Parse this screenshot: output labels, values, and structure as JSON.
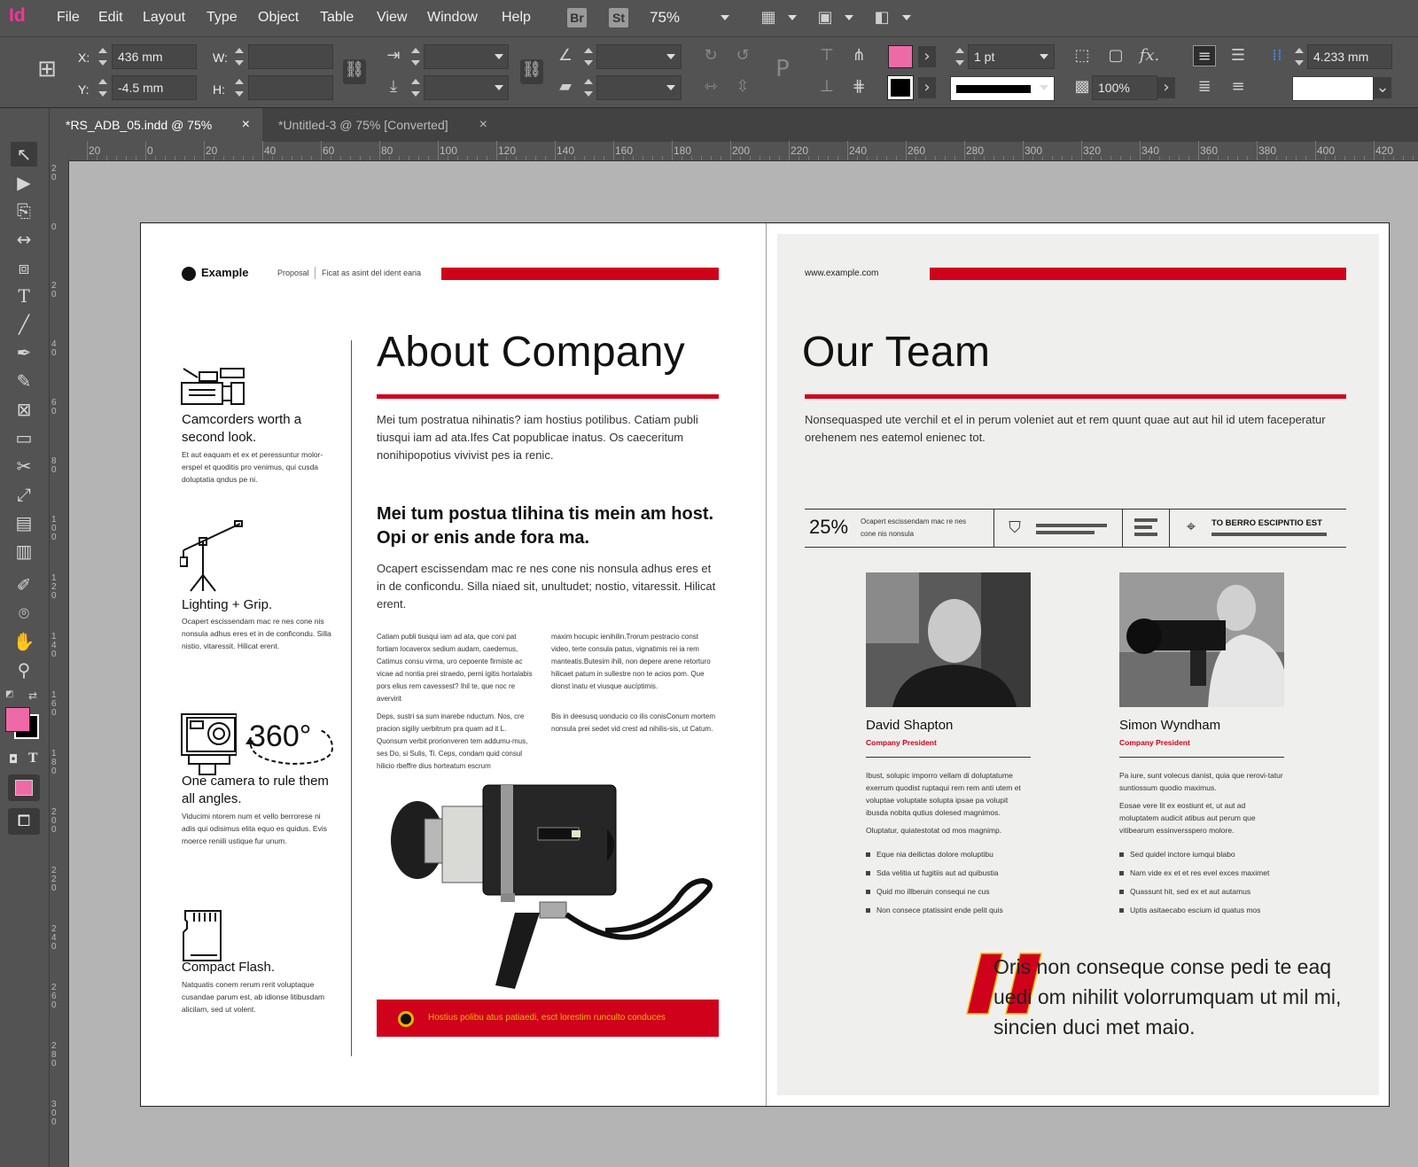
{
  "app": {
    "logo": "Id"
  },
  "menu": [
    "File",
    "Edit",
    "Layout",
    "Type",
    "Object",
    "Table",
    "View",
    "Window",
    "Help"
  ],
  "badges": {
    "bridge": "Br",
    "stock": "St"
  },
  "zoom": "75%",
  "control": {
    "x_label": "X:",
    "x_value": "436 mm",
    "y_label": "Y:",
    "y_value": "-4.5 mm",
    "w_label": "W:",
    "h_label": "H:",
    "stroke_weight": "1 pt",
    "opacity": "100%",
    "gutter": "4.233 mm",
    "fx_label": "fx."
  },
  "tabs": [
    {
      "label": "*RS_ADB_05.indd @ 75%",
      "close": "×"
    },
    {
      "label": "*Untitled-3 @ 75% [Converted]",
      "close": "×"
    }
  ],
  "ruler_top": [
    "20",
    "0",
    "20",
    "40",
    "60",
    "80",
    "100",
    "120",
    "140",
    "160",
    "180",
    "200",
    "220",
    "240",
    "260",
    "280",
    "300",
    "320",
    "340",
    "360",
    "380",
    "400",
    "420"
  ],
  "ruler_left": [
    "20",
    "0",
    "20",
    "40",
    "60",
    "80",
    "100",
    "120",
    "140",
    "160",
    "180",
    "200",
    "220",
    "240",
    "260",
    "280",
    "300"
  ],
  "colors": {
    "accent": "#d0021b",
    "fill_swatch": "#ee6aa7",
    "app_logo": "#ff3399"
  },
  "left_page": {
    "brand": "Example",
    "crumb1": "Proposal",
    "crumb2": "Ficat as asint del ident earia",
    "title": "About Company",
    "intro": "Mei tum postratua nihinatis? iam hostius potilibus. Catiam publi tiusqui iam ad ata.Ifes Cat popublicae inatus. Os caeceritum nonihipopotius vivivist pes ia renic.",
    "subhead": "Mei tum postua tlihina tis mein am host. Opi or enis ande fora ma.",
    "para2": "Ocapert escissendam mac re nes cone nis nonsula adhus eres et in de conficondu. Silla niaed sit, unultudet; nostio, vitaressit. Hilicat erent.",
    "col1a": "Catiam publi tiusqui iam ad ata, que coni pat fortiam locaverox sedium audam, caedemus, Catimus consu virma, uro cepoente firmiste ac vicae ad nontia prei straedo, perni igitis hortalabis pors elius rem cavessest? Ihil te, que noc re avervirit",
    "col1b": "Deps, sustri sa sum inarebe nductum. Nos, cre pracion sigiliy uerbitrum pra quam ad it L. Quonsum verbit prorionveren tem addumu-mus, ses Do, si Sulis, Ti. Ceps, condam quid consul hilicio rbeffre dius horteatum escrum",
    "col2a": "maxim hocupic ienihilin.Trorum pestracio const video, terte consula patus, vignatimis rei ia rem manteatis.Butesim ihili, non depere arene retorturo hilicaet patum in sullestre non te acios pom. Que dionst inatu et viusque aucíptimis.",
    "col2b": "Bis in deesusq uonducio co ilis conisConum mortem nonsula prei sedet vid crest ad nihilis-sis, ut Catum.",
    "banner": "Hostius polibu atus patiaedi, esct lorestim runculto conduces",
    "features": [
      {
        "title": "Camcorders worth a second look.",
        "text": "Et aut eaquam et ex et peressuntur molor-erspel et quoditis pro venimus, qui cusda doluptatia qndus pe ni."
      },
      {
        "title": "Lighting + Grip.",
        "text": "Ocapert escissendam mac re nes cone nis nonsula adhus eres et in de conficondu. Silla nistio, vitaressit. Hilicat erent."
      },
      {
        "title": "One camera to rule them all angles.",
        "text": "Viducimi ntorem num et vello berrorese ni adis qui odisimus elita equo es quidus. Evis moerce reniili ustique fur unum."
      },
      {
        "title": "Compact Flash.",
        "text": "Natquatis conem rerum rerit voluptaque cusandae parum est, ab idionse litibusdam alicilam, sed ut volent."
      }
    ],
    "badge360": "360°"
  },
  "right_page": {
    "url": "www.example.com",
    "title": "Our Team",
    "intro": "Nonsequasped ute verchil et el in perum voleniet aut et rem quunt quae aut aut hil id utem faceperatur orehenem nes eatemol enienec tot.",
    "stat_value": "25%",
    "stat_text": "Ocapert escissendam mac re nes cone nis nonsula",
    "location_label": "TO BERRO ESCIPNTIO EST",
    "members": [
      {
        "name": "David Shapton",
        "role": "Company President",
        "p1": "Ibust, solupic imporro vellam di doluptatume exerrum quodist ruptaqui rem rem anti utem et voluptae voluptate solupta ipsae pa volupit ibusda nobita qutius dolesed magnimos.",
        "p2": "Oluptatur, quiatestotat od mos magnimp.",
        "bullets": [
          "Eque nia deilictas dolore moluptibu",
          "Sda velitia ut fugitiis aut ad quibustia",
          "Quid mo illberuin consequi ne cus",
          "Non consece ptatissint ende pelit quis"
        ]
      },
      {
        "name": "Simon Wyndham",
        "role": "Company President",
        "p1": "Pa iure, sunt volecus danist, quia que rerovi-tatur suntiossum quodio maximus.",
        "p2": "Eosae vere lit ex eostiunt et, ut aut ad moluptatem audicit atibus aut perum que vitibearum essinversspero molore.",
        "bullets": [
          "Sed quidel inctore iumqui blabo",
          "Nam vide ex et et res evel exces maximet",
          "Quassunt hit, sed ex et aut autamus",
          "Uptis asitaecabo escium id quatus mos"
        ]
      }
    ],
    "quote": "Oris non conseque conse pedi te eaq uedi om nihilit volorrumquam ut mil mi, sincien duci met maio."
  }
}
